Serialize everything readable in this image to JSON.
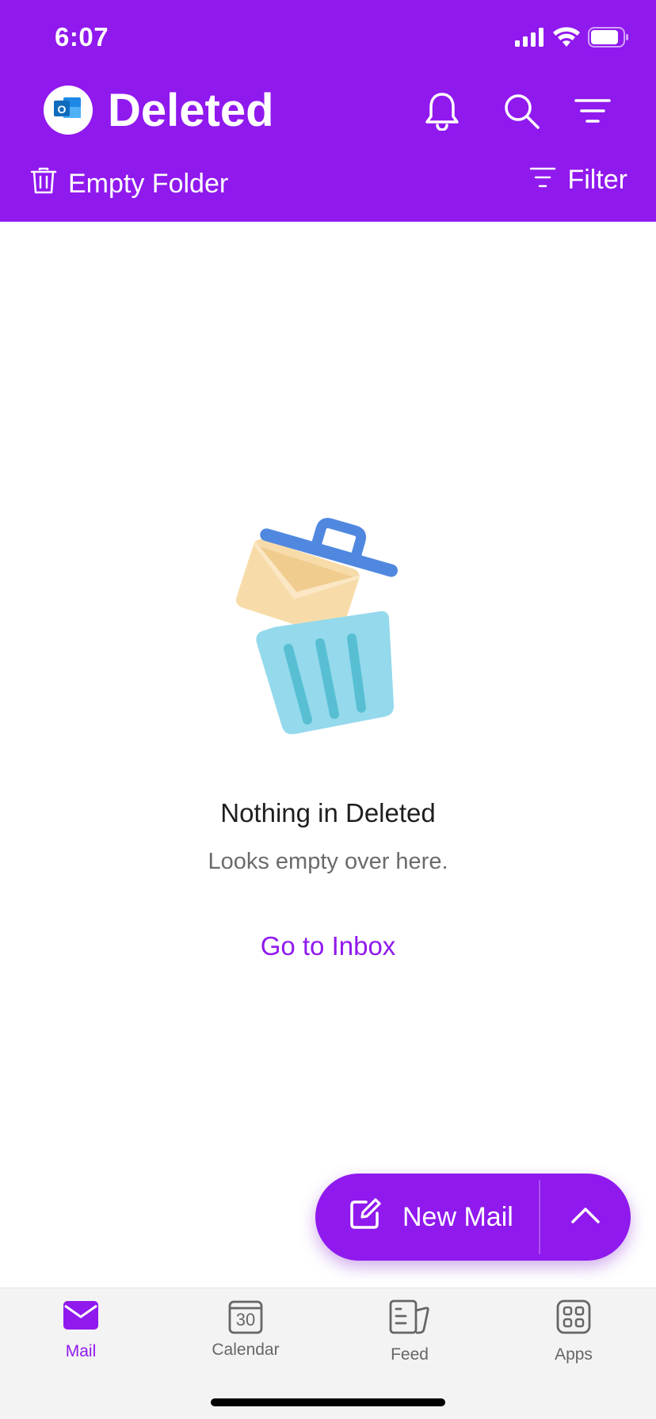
{
  "status_bar": {
    "time": "6:07"
  },
  "header": {
    "title": "Deleted",
    "empty_folder_label": "Empty Folder",
    "filter_label": "Filter"
  },
  "empty_state": {
    "title": "Nothing in Deleted",
    "subtitle": "Looks empty over here.",
    "action_label": "Go to Inbox"
  },
  "fab": {
    "label": "New Mail"
  },
  "tabs": [
    {
      "label": "Mail",
      "active": true
    },
    {
      "label": "Calendar",
      "icon_text": "30"
    },
    {
      "label": "Feed"
    },
    {
      "label": "Apps"
    }
  ],
  "colors": {
    "accent": "#9019ee",
    "tab_bar": "#f3f3f3",
    "trash_blue": "#5088e0",
    "trash_body": "#94d9ec",
    "envelope": "#f7dcaa"
  }
}
